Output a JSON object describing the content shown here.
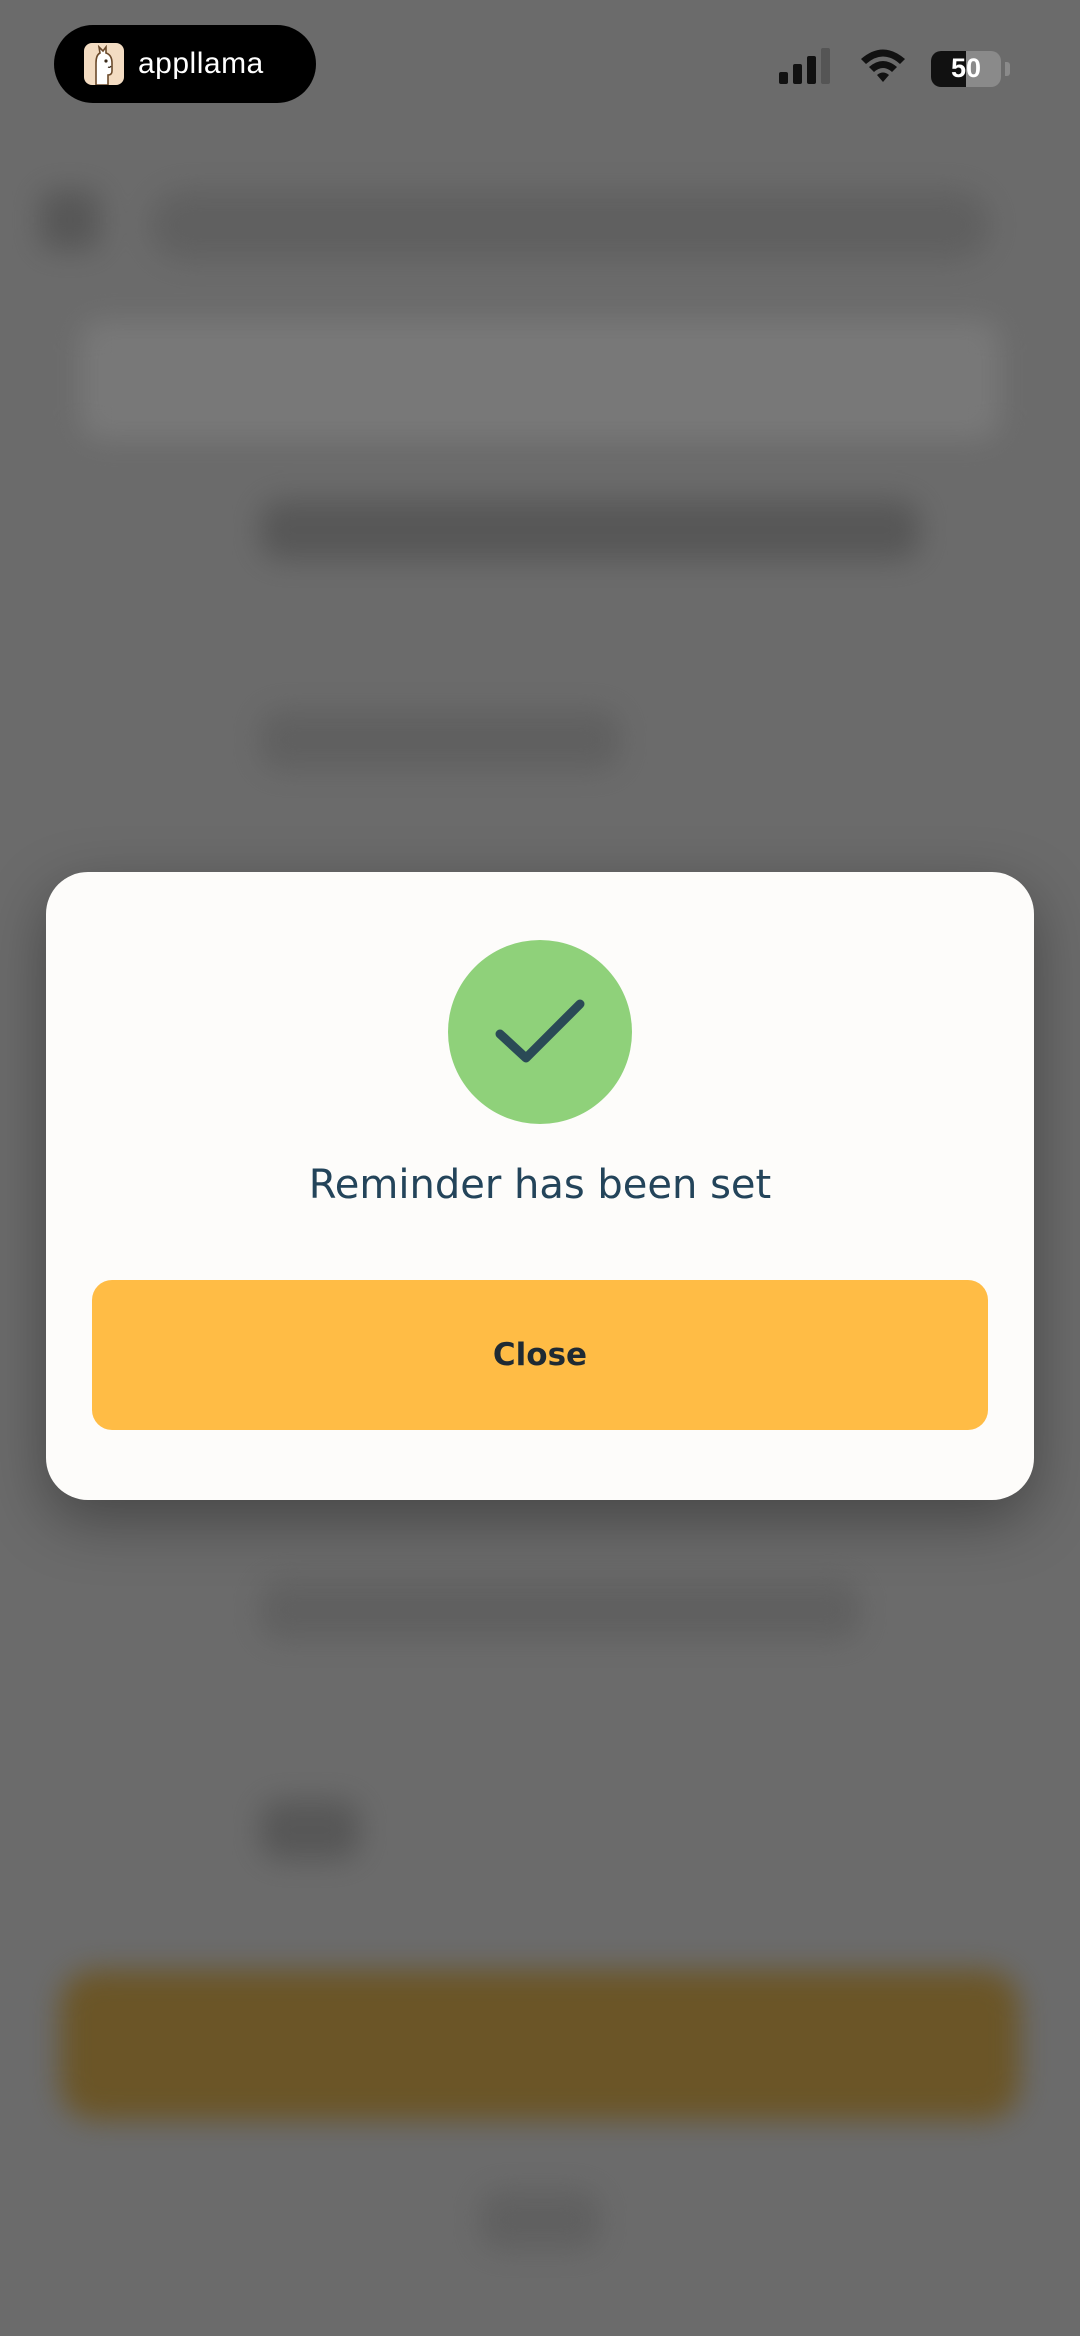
{
  "status_bar": {
    "brand": {
      "name": "appllama",
      "logo_icon": "llama-icon"
    },
    "signal_icon": "cellular-signal-icon",
    "wifi_icon": "wifi-icon",
    "battery": {
      "level_percent": 50,
      "label": "50"
    }
  },
  "modal": {
    "icon": "checkmark-icon",
    "title": "Reminder has been set",
    "close_label": "Close"
  },
  "colors": {
    "overlay": "#6b6b6b",
    "modal_bg": "#fdfcfa",
    "success": "#8fd17a",
    "checkmark": "#2a4a56",
    "title_text": "#23445a",
    "button": "#ffbc45",
    "button_text": "#1f2a33"
  }
}
